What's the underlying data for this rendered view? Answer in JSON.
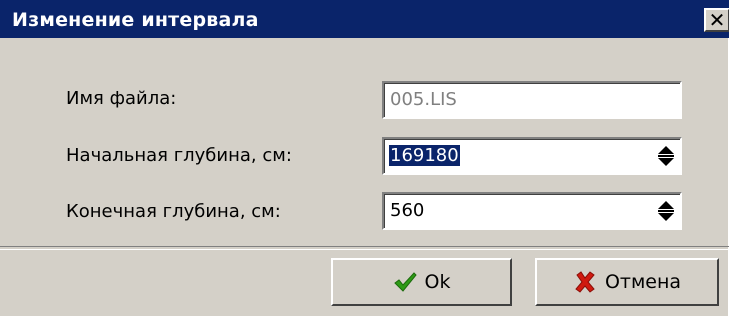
{
  "window": {
    "title": "Изменение интервала"
  },
  "title_bar": {
    "close_icon": "close-x-icon"
  },
  "fields": [
    {
      "label": "Имя файла:",
      "value": "005.LIS",
      "state": "disabled"
    },
    {
      "label": "Начальная глубина, см:",
      "value": "169180",
      "state": "selected"
    },
    {
      "label": "Конечная глубина, см:",
      "value": "560",
      "state": "normal"
    }
  ],
  "buttons": {
    "ok_label": "Ok",
    "ok_icon": "checkmark-icon",
    "cancel_label": "Отмена",
    "cancel_icon": "red-x-icon"
  },
  "colors": {
    "title_bar": "#0a246a",
    "dialog_bg": "#d4d0c8",
    "ok_icon": "#2e9b16",
    "cancel_icon": "#d01a10"
  }
}
